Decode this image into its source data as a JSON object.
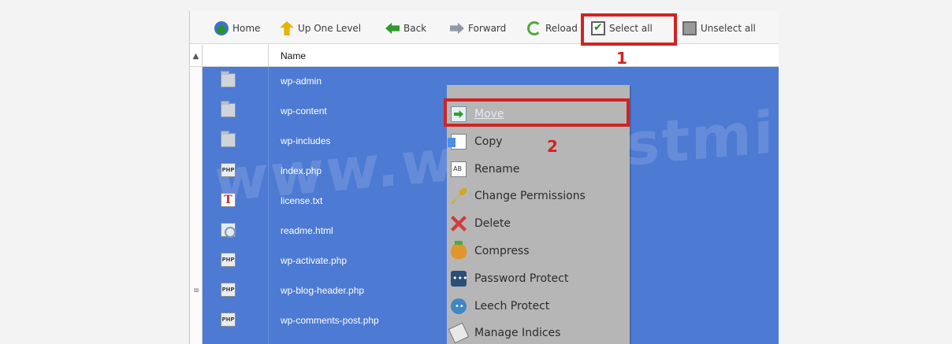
{
  "toolbar": {
    "home": "Home",
    "up": "Up One Level",
    "back": "Back",
    "forward": "Forward",
    "reload": "Reload",
    "select_all": "Select all",
    "unselect_all": "Unselect all"
  },
  "annotations": {
    "one": "1",
    "two": "2"
  },
  "table": {
    "name_header": "Name"
  },
  "files": [
    {
      "name": "wp-admin",
      "icon": "folder-icon"
    },
    {
      "name": "wp-content",
      "icon": "folder-icon"
    },
    {
      "name": "wp-includes",
      "icon": "folder-icon"
    },
    {
      "name": "index.php",
      "icon": "php-file-icon",
      "glyph": "PHP"
    },
    {
      "name": "license.txt",
      "icon": "text-file-icon",
      "glyph": "T"
    },
    {
      "name": "readme.html",
      "icon": "html-file-icon"
    },
    {
      "name": "wp-activate.php",
      "icon": "php-file-icon",
      "glyph": "PHP"
    },
    {
      "name": "wp-blog-header.php",
      "icon": "php-file-icon",
      "glyph": "PHP"
    },
    {
      "name": "wp-comments-post.php",
      "icon": "php-file-icon",
      "glyph": "PHP"
    }
  ],
  "context_menu": {
    "move": "Move",
    "copy": "Copy",
    "rename": "Rename",
    "change_permissions": "Change Permissions",
    "delete": "Delete",
    "compress": "Compress",
    "password_protect": "Password Protect",
    "leech_protect": "Leech Protect",
    "manage_indices": "Manage Indices"
  },
  "watermark": "www.webhostmin.com",
  "colors": {
    "selection": "#4d7ad3",
    "menu": "#b6b6b6",
    "annotation": "#d02323"
  }
}
